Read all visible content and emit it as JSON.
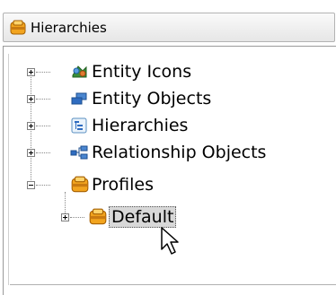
{
  "header": {
    "title": "Hierarchies",
    "icon": "profile-folder-icon"
  },
  "tree": {
    "items": [
      {
        "label": "Entity Icons",
        "icon": "entity-icons-icon",
        "expanded": false,
        "selected": false
      },
      {
        "label": "Entity Objects",
        "icon": "entity-objects-icon",
        "expanded": false,
        "selected": false
      },
      {
        "label": "Hierarchies",
        "icon": "hierarchies-icon",
        "expanded": false,
        "selected": false
      },
      {
        "label": "Relationship Objects",
        "icon": "relationship-objects-icon",
        "expanded": false,
        "selected": false
      },
      {
        "label": "Profiles",
        "icon": "profile-folder-icon",
        "expanded": true,
        "selected": false,
        "children": [
          {
            "label": "Default",
            "icon": "profile-folder-icon",
            "expanded": false,
            "selected": true
          }
        ]
      }
    ]
  },
  "colors": {
    "folder_orange": "#f0a020",
    "selection_bg": "#d8d8d8"
  }
}
